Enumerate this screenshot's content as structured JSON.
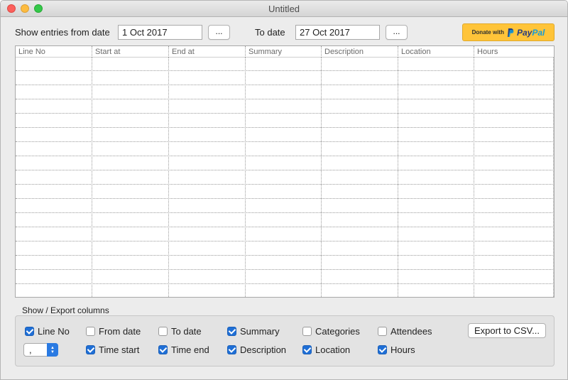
{
  "window": {
    "title": "Untitled"
  },
  "filter": {
    "from_label": "Show entries from date",
    "from_value": "1 Oct 2017",
    "to_label": "To date",
    "to_value": "27 Oct 2017",
    "picker_label": "..."
  },
  "donate": {
    "prefix": "Donate with",
    "brand_a": "Pay",
    "brand_b": "Pal"
  },
  "table": {
    "columns": [
      "Line No",
      "Start at",
      "End at",
      "Summary",
      "Description",
      "Location",
      "Hours"
    ],
    "rows": []
  },
  "columns_group": {
    "title": "Show / Export columns",
    "checkboxes": [
      {
        "label": "Line No",
        "checked": true
      },
      {
        "label": "From date",
        "checked": false
      },
      {
        "label": "To date",
        "checked": false
      },
      {
        "label": "Summary",
        "checked": true
      },
      {
        "label": "Categories",
        "checked": false
      },
      {
        "label": "Attendees",
        "checked": false
      },
      {
        "label": "Time start",
        "checked": true
      },
      {
        "label": "Time end",
        "checked": true
      },
      {
        "label": "Description",
        "checked": true
      },
      {
        "label": "Location",
        "checked": true
      },
      {
        "label": "Hours",
        "checked": true
      }
    ],
    "separator_value": ",",
    "export_label": "Export to CSV..."
  }
}
